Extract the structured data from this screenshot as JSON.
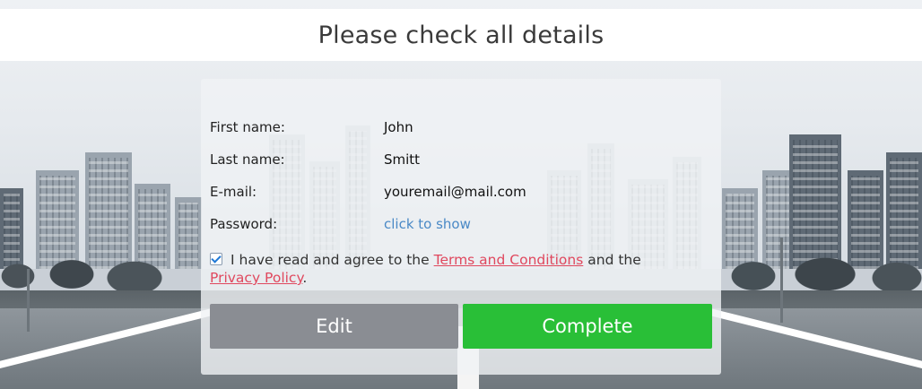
{
  "header": {
    "title": "Please check all details"
  },
  "details": [
    {
      "label": "First name:",
      "value": "John"
    },
    {
      "label": "Last name:",
      "value": "Smitt"
    },
    {
      "label": "E-mail:",
      "value": "youremail@mail.com"
    },
    {
      "label": "Password:",
      "value": "click to show"
    }
  ],
  "agreement": {
    "checked": true,
    "text_before": "I have read and agree to the",
    "terms_link": "Terms and Conditions",
    "text_middle": "and the",
    "privacy_link": "Privacy Policy",
    "text_after": "."
  },
  "buttons": {
    "edit": "Edit",
    "complete": "Complete"
  },
  "colors": {
    "edit_button": "#8a8d93",
    "complete_button": "#29bf37",
    "link": "#e0485e",
    "password_link": "#4a89c6"
  }
}
